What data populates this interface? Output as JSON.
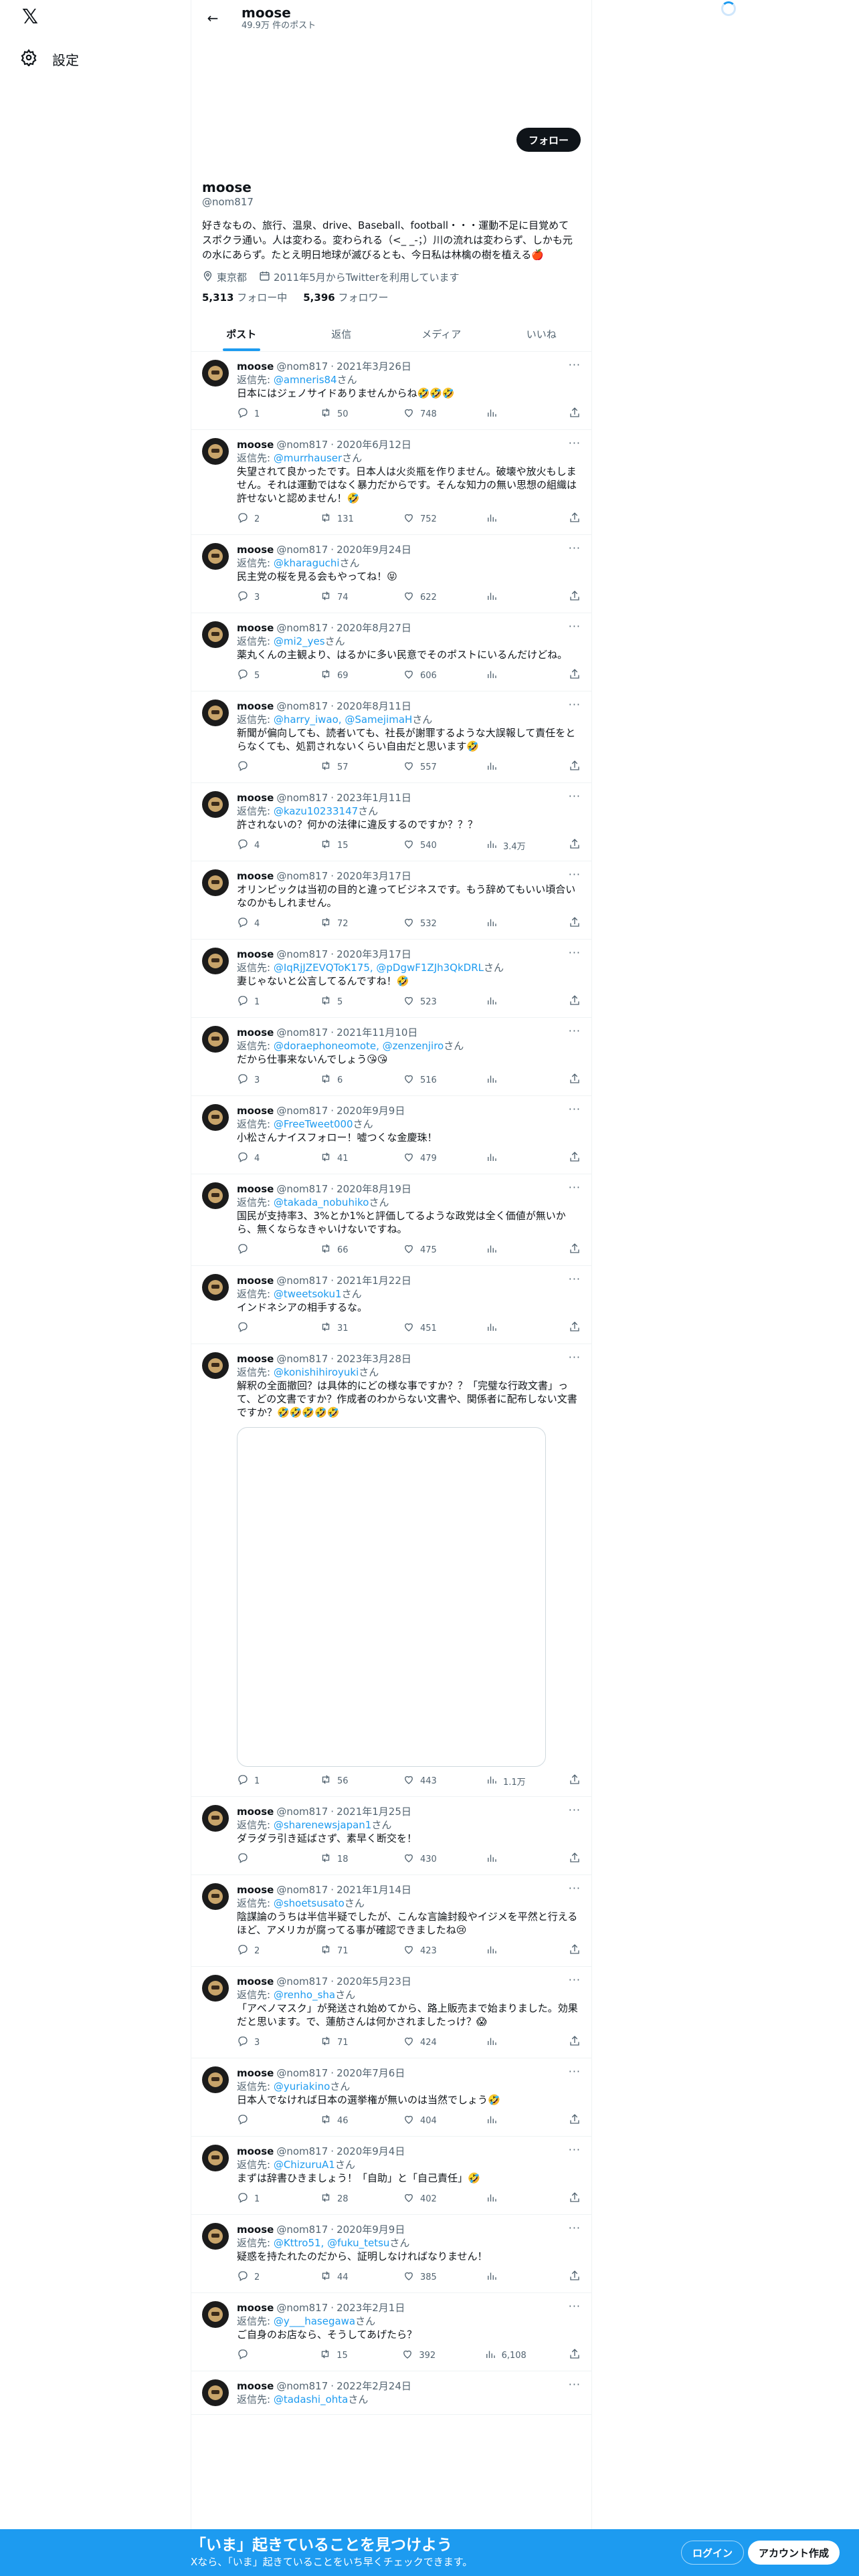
{
  "nav": {
    "settings_label": "設定"
  },
  "header": {
    "name": "moose",
    "post_count": "49.9万 件のポスト"
  },
  "profile": {
    "follow_label": "フォロー",
    "name": "moose",
    "handle": "@nom817",
    "bio": "好きなもの、旅行、温泉、drive、Baseball、football・・・運動不足に目覚めて スポクラ通い。人は変わる。変わられる（<_ _-；）川の流れは変わらず、しかも元の水にあらず。たとえ明日地球が滅びるとも、今日私は林檎の樹を植える🍎",
    "location": "東京都",
    "joined": "2011年5月からTwitterを利用しています",
    "following_count": "5,313",
    "following_label": "フォロー中",
    "followers_count": "5,396",
    "followers_label": "フォロワー"
  },
  "tabs": [
    "ポスト",
    "返信",
    "メディア",
    "いいね"
  ],
  "reply_prefix": "返信先: ",
  "reply_suffix": "さん",
  "tweets": [
    {
      "name": "moose",
      "handle": "@nom817",
      "date": "2021年3月26日",
      "reply_to": "@amneris84",
      "text": "日本にはジェノサイドありませんからね🤣🤣🤣",
      "replies": "1",
      "retweets": "50",
      "likes": "748",
      "views": ""
    },
    {
      "name": "moose",
      "handle": "@nom817",
      "date": "2020年6月12日",
      "reply_to": "@murrhauser",
      "text": "失望されて良かったです。日本人は火炎瓶を作りません。破壊や放火もしません。それは運動ではなく暴力だからです。そんな知力の無い思想の組織は許せないと認めません！🤣",
      "replies": "2",
      "retweets": "131",
      "likes": "752",
      "views": ""
    },
    {
      "name": "moose",
      "handle": "@nom817",
      "date": "2020年9月24日",
      "reply_to": "@kharaguchi",
      "text": "民主党の桜を見る会もやってね！😝",
      "replies": "3",
      "retweets": "74",
      "likes": "622",
      "views": ""
    },
    {
      "name": "moose",
      "handle": "@nom817",
      "date": "2020年8月27日",
      "reply_to": "@mi2_yes",
      "text": "薬丸くんの主観より、はるかに多い民意でそのポストにいるんだけどね。",
      "replies": "5",
      "retweets": "69",
      "likes": "606",
      "views": ""
    },
    {
      "name": "moose",
      "handle": "@nom817",
      "date": "2020年8月11日",
      "reply_to": "@harry_iwao, @SamejimaH",
      "text": "新聞が偏向しても、読者いても、社長が謝罪するような大誤報して責任をとらなくても、処罰されないくらい自由だと思います🤣",
      "replies": "",
      "retweets": "57",
      "likes": "557",
      "views": ""
    },
    {
      "name": "moose",
      "handle": "@nom817",
      "date": "2023年1月11日",
      "reply_to": "@kazu10233147",
      "text": "許されないの？何かの法律に違反するのですか？？？",
      "replies": "4",
      "retweets": "15",
      "likes": "540",
      "views": "3.4万"
    },
    {
      "name": "moose",
      "handle": "@nom817",
      "date": "2020年3月17日",
      "reply_to": "",
      "text": "オリンピックは当初の目的と違ってビジネスです。もう辞めてもいい頃合いなのかもしれません。",
      "replies": "4",
      "retweets": "72",
      "likes": "532",
      "views": ""
    },
    {
      "name": "moose",
      "handle": "@nom817",
      "date": "2020年3月17日",
      "reply_to": "@IqRjJZEVQToK175, @pDgwF1ZJh3QkDRL",
      "text": "妻じゃないと公言してるんですね！🤣",
      "replies": "1",
      "retweets": "5",
      "likes": "523",
      "views": ""
    },
    {
      "name": "moose",
      "handle": "@nom817",
      "date": "2021年11月10日",
      "reply_to": "@doraephoneomote, @zenzenjiro",
      "text": "だから仕事来ないんでしょう😘😘",
      "replies": "3",
      "retweets": "6",
      "likes": "516",
      "views": ""
    },
    {
      "name": "moose",
      "handle": "@nom817",
      "date": "2020年9月9日",
      "reply_to": "@FreeTweet000",
      "text": "小松さんナイスフォロー！嘘つくな金慶珠！",
      "replies": "4",
      "retweets": "41",
      "likes": "479",
      "views": ""
    },
    {
      "name": "moose",
      "handle": "@nom817",
      "date": "2020年8月19日",
      "reply_to": "@takada_nobuhiko",
      "text": "国民が支持率3、3%とか1%と評価してるような政党は全く価値が無いから、無くならなきゃいけないですね。",
      "replies": "",
      "retweets": "66",
      "likes": "475",
      "views": ""
    },
    {
      "name": "moose",
      "handle": "@nom817",
      "date": "2021年1月22日",
      "reply_to": "@tweetsoku1",
      "text": "インドネシアの相手するな。",
      "replies": "",
      "retweets": "31",
      "likes": "451",
      "views": ""
    },
    {
      "name": "moose",
      "handle": "@nom817",
      "date": "2023年3月28日",
      "reply_to": "@konishihiroyuki",
      "text": "解釈の全面撤回？は具体的にどの様な事ですか？？「完璧な行政文書」って、どの文書ですか？作成者のわからない文書や、関係者に配布しない文書ですか？🤣🤣🤣🤣🤣",
      "replies": "1",
      "retweets": "56",
      "likes": "443",
      "views": "1.1万",
      "media": true
    },
    {
      "name": "moose",
      "handle": "@nom817",
      "date": "2021年1月25日",
      "reply_to": "@sharenewsjapan1",
      "text": "ダラダラ引き延ばさず、素早く断交を！",
      "replies": "",
      "retweets": "18",
      "likes": "430",
      "views": ""
    },
    {
      "name": "moose",
      "handle": "@nom817",
      "date": "2021年1月14日",
      "reply_to": "@shoetsusato",
      "text": "陰謀論のうちは半信半疑でしたが、こんな言論封殺やイジメを平然と行えるほど、アメリカが腐ってる事が確認できましたね😢",
      "replies": "2",
      "retweets": "71",
      "likes": "423",
      "views": ""
    },
    {
      "name": "moose",
      "handle": "@nom817",
      "date": "2020年5月23日",
      "reply_to": "@renho_sha",
      "text": "「アベノマスク」が発送され始めてから、路上販売まで始まりました。効果だと思います。で、蓮舫さんは何かされましたっけ？😱",
      "replies": "3",
      "retweets": "71",
      "likes": "424",
      "views": ""
    },
    {
      "name": "moose",
      "handle": "@nom817",
      "date": "2020年7月6日",
      "reply_to": "@yuriakino",
      "text": "日本人でなければ日本の選挙権が無いのは当然でしょう🤣",
      "replies": "",
      "retweets": "46",
      "likes": "404",
      "views": ""
    },
    {
      "name": "moose",
      "handle": "@nom817",
      "date": "2020年9月4日",
      "reply_to": "@ChizuruA1",
      "text": "まずは辞書ひきましょう！「自助」と「自己責任」🤣",
      "replies": "1",
      "retweets": "28",
      "likes": "402",
      "views": ""
    },
    {
      "name": "moose",
      "handle": "@nom817",
      "date": "2020年9月9日",
      "reply_to": "@Kttro51, @fuku_tetsu",
      "text": "疑惑を持たれたのだから、証明しなければなりません！",
      "replies": "2",
      "retweets": "44",
      "likes": "385",
      "views": ""
    },
    {
      "name": "moose",
      "handle": "@nom817",
      "date": "2023年2月1日",
      "reply_to": "@y___hasegawa",
      "text": "ご自身のお店なら、そうしてあげたら？",
      "replies": "",
      "retweets": "15",
      "likes": "392",
      "views": "6,108"
    },
    {
      "name": "moose",
      "handle": "@nom817",
      "date": "2022年2月24日",
      "reply_to": "@tadashi_ohta",
      "text": "",
      "replies": "",
      "retweets": "",
      "likes": "",
      "views": ""
    }
  ],
  "bottom_bar": {
    "title": "「いま」起きていることを見つけよう",
    "subtitle": "Xなら、「いま」起きていることをいち早くチェックできます。",
    "login_label": "ログイン",
    "signup_label": "アカウント作成"
  }
}
